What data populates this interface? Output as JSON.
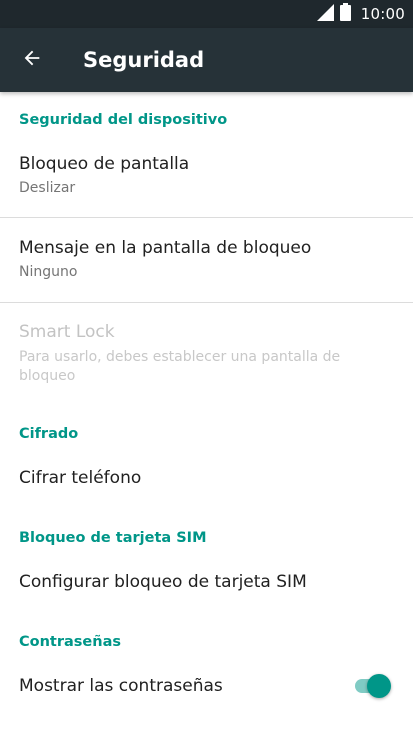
{
  "status_bar": {
    "time": "10:00",
    "icons": [
      "signal-icon",
      "battery-icon"
    ]
  },
  "app_bar": {
    "back_icon": "back-arrow-icon",
    "title": "Seguridad"
  },
  "sections": {
    "device_security": {
      "header": "Seguridad del dispositivo",
      "screen_lock": {
        "title": "Bloqueo de pantalla",
        "subtitle": "Deslizar"
      },
      "lock_screen_message": {
        "title": "Mensaje en la pantalla de bloqueo",
        "subtitle": "Ninguno"
      },
      "smart_lock": {
        "title": "Smart Lock",
        "subtitle": "Para usarlo, debes establecer una pantalla de bloqueo",
        "enabled": false
      }
    },
    "encryption": {
      "header": "Cifrado",
      "encrypt_phone": {
        "title": "Cifrar teléfono"
      }
    },
    "sim_lock": {
      "header": "Bloqueo de tarjeta SIM",
      "configure_sim_lock": {
        "title": "Configurar bloqueo de tarjeta SIM"
      }
    },
    "passwords": {
      "header": "Contraseñas",
      "show_passwords": {
        "title": "Mostrar las contraseñas",
        "toggle_on": true
      }
    }
  },
  "colors": {
    "status_bar": "#1f282d",
    "app_bar": "#263238",
    "accent": "#009688",
    "accent_light": "#80cbc4"
  }
}
